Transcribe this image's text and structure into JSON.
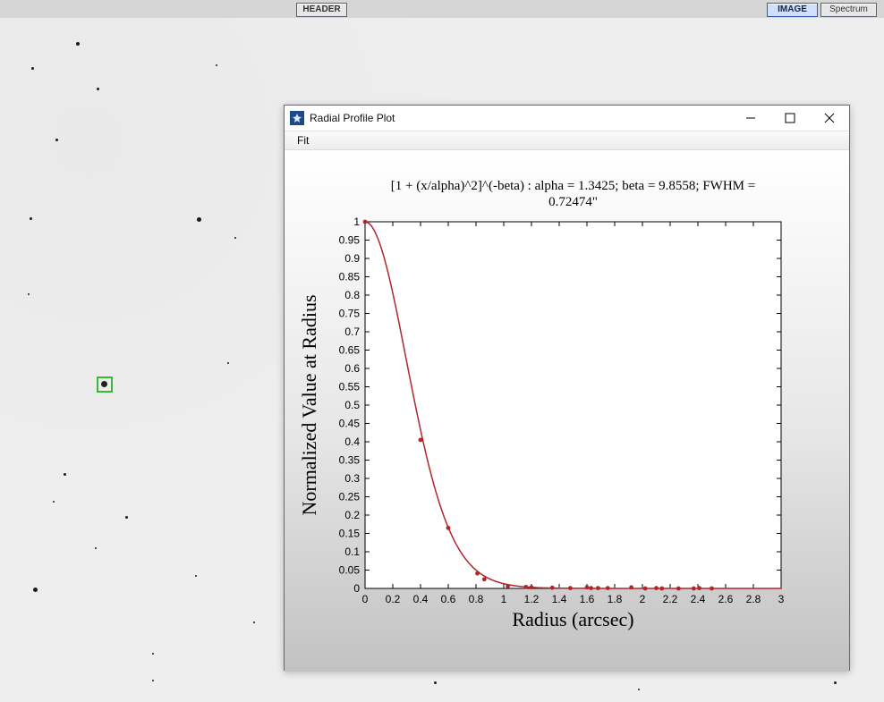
{
  "toolbar": {
    "header_btn": "HEADER",
    "image_btn": "IMAGE",
    "spectrum_btn": "Spectrum"
  },
  "window": {
    "title": "Radial Profile Plot",
    "menu_fit": "Fit"
  },
  "chart_data": {
    "type": "scatter",
    "title_line1": "[1 + (x/alpha)^2]^(-beta) : alpha = 1.3425; beta = 9.8558; FWHM =",
    "title_line2": "0.72474\"",
    "xlabel": "Radius (arcsec)",
    "ylabel": "Normalized Value at Radius",
    "xlim": [
      0,
      3
    ],
    "ylim": [
      0,
      1
    ],
    "xticks": [
      0,
      0.2,
      0.4,
      0.6,
      0.8,
      1,
      1.2,
      1.4,
      1.6,
      1.8,
      2,
      2.2,
      2.4,
      2.6,
      2.8,
      3
    ],
    "yticks": [
      0,
      0.05,
      0.1,
      0.15,
      0.2,
      0.25,
      0.3,
      0.35,
      0.4,
      0.45,
      0.5,
      0.55,
      0.6,
      0.65,
      0.7,
      0.75,
      0.8,
      0.85,
      0.9,
      0.95,
      1
    ],
    "fit": {
      "alpha": 1.3425,
      "beta": 9.8558,
      "fwhm_arcsec": 0.72474
    },
    "points": [
      {
        "x": 0.0,
        "y": 1.0
      },
      {
        "x": 0.4,
        "y": 0.405
      },
      {
        "x": 0.6,
        "y": 0.165
      },
      {
        "x": 0.81,
        "y": 0.041
      },
      {
        "x": 0.86,
        "y": 0.025
      },
      {
        "x": 1.03,
        "y": 0.006
      },
      {
        "x": 1.16,
        "y": 0.004
      },
      {
        "x": 1.2,
        "y": 0.003
      },
      {
        "x": 1.35,
        "y": 0.002
      },
      {
        "x": 1.48,
        "y": 0.001
      },
      {
        "x": 1.6,
        "y": 0.003
      },
      {
        "x": 1.63,
        "y": 0.001
      },
      {
        "x": 1.68,
        "y": 0.001
      },
      {
        "x": 1.75,
        "y": 0.001
      },
      {
        "x": 1.92,
        "y": 0.003
      },
      {
        "x": 2.02,
        "y": 0.0
      },
      {
        "x": 2.1,
        "y": 0.001
      },
      {
        "x": 2.14,
        "y": 0.0
      },
      {
        "x": 2.26,
        "y": 0.0
      },
      {
        "x": 2.37,
        "y": 0.0
      },
      {
        "x": 2.41,
        "y": 0.001
      },
      {
        "x": 2.5,
        "y": 0.0
      }
    ]
  }
}
